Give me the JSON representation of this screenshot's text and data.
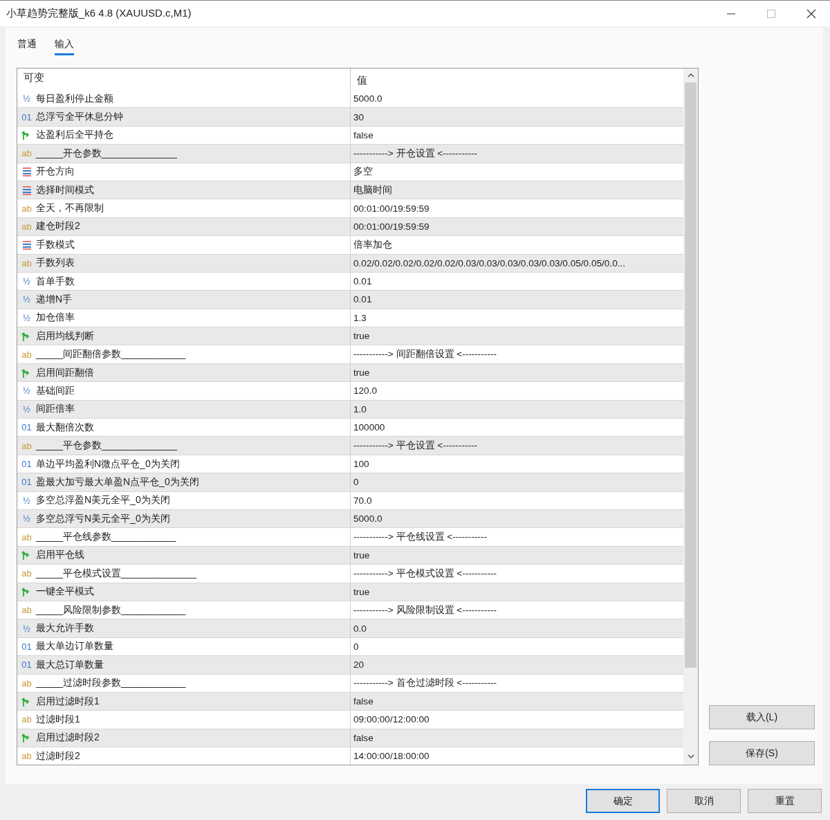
{
  "window": {
    "title": "小草趋势完整版_k6 4.8 (XAUUSD.c,M1)"
  },
  "tabs": [
    {
      "label": "普通",
      "selected": false
    },
    {
      "label": "输入",
      "selected": true
    }
  ],
  "table": {
    "columns": [
      "可变",
      "值"
    ],
    "rows": [
      {
        "kind": "double",
        "type_label": "½",
        "name": "每日盈利停止金额",
        "value": "5000.0"
      },
      {
        "kind": "int",
        "type_label": "01",
        "name": "总浮亏全平休息分钟",
        "value": "30"
      },
      {
        "kind": "bool",
        "name": "达盈利后全平持仓",
        "value": "false"
      },
      {
        "kind": "string",
        "type_label": "ab",
        "name": "_____开仓参数______________",
        "value": "-----------> 开仓设置 <-----------"
      },
      {
        "kind": "enum",
        "name": "开仓方向",
        "value": "多空"
      },
      {
        "kind": "enum",
        "name": "选择时间模式",
        "value": "电脑时间"
      },
      {
        "kind": "string",
        "type_label": "ab",
        "name": "全天，不再限制",
        "value": "00:01:00/19:59:59"
      },
      {
        "kind": "string",
        "type_label": "ab",
        "name": "建仓时段2",
        "value": "00:01:00/19:59:59"
      },
      {
        "kind": "enum",
        "name": "手数模式",
        "value": "倍率加仓"
      },
      {
        "kind": "string",
        "type_label": "ab",
        "name": "手数列表",
        "value": "0.02/0.02/0.02/0.02/0.02/0.03/0.03/0.03/0.03/0.03/0.05/0.05/0.0..."
      },
      {
        "kind": "double",
        "type_label": "½",
        "name": "首单手数",
        "value": "0.01"
      },
      {
        "kind": "double",
        "type_label": "½",
        "name": "递增N手",
        "value": "0.01"
      },
      {
        "kind": "double",
        "type_label": "½",
        "name": "加仓倍率",
        "value": "1.3"
      },
      {
        "kind": "bool",
        "name": "启用均线判断",
        "value": "true"
      },
      {
        "kind": "string",
        "type_label": "ab",
        "name": "_____间距翻倍参数____________",
        "value": "-----------> 间距翻倍设置 <-----------"
      },
      {
        "kind": "bool",
        "name": "启用间距翻倍",
        "value": "true"
      },
      {
        "kind": "double",
        "type_label": "½",
        "name": "基础间距",
        "value": "120.0"
      },
      {
        "kind": "double",
        "type_label": "½",
        "name": "间距倍率",
        "value": "1.0"
      },
      {
        "kind": "int",
        "type_label": "01",
        "name": "最大翻倍次数",
        "value": "100000"
      },
      {
        "kind": "string",
        "type_label": "ab",
        "name": "_____平仓参数______________",
        "value": "-----------> 平仓设置 <-----------"
      },
      {
        "kind": "int",
        "type_label": "01",
        "name": "单边平均盈利N微点平仓_0为关闭",
        "value": "100"
      },
      {
        "kind": "int",
        "type_label": "01",
        "name": "盈最大加亏最大单盈N点平仓_0为关闭",
        "value": "0"
      },
      {
        "kind": "double",
        "type_label": "½",
        "name": "多空总浮盈N美元全平_0为关闭",
        "value": "70.0"
      },
      {
        "kind": "double",
        "type_label": "½",
        "name": "多空总浮亏N美元全平_0为关闭",
        "value": "5000.0"
      },
      {
        "kind": "string",
        "type_label": "ab",
        "name": "_____平仓线参数____________",
        "value": "-----------> 平仓线设置 <-----------"
      },
      {
        "kind": "bool",
        "name": "启用平仓线",
        "value": "true"
      },
      {
        "kind": "string",
        "type_label": "ab",
        "name": "_____平仓模式设置______________",
        "value": "-----------> 平仓模式设置 <-----------"
      },
      {
        "kind": "bool",
        "name": "一键全平模式",
        "value": "true"
      },
      {
        "kind": "string",
        "type_label": "ab",
        "name": "_____风险限制参数____________",
        "value": "-----------> 风险限制设置 <-----------"
      },
      {
        "kind": "double",
        "type_label": "½",
        "name": "最大允许手数",
        "value": "0.0"
      },
      {
        "kind": "int",
        "type_label": "01",
        "name": "最大单边订单数量",
        "value": "0"
      },
      {
        "kind": "int",
        "type_label": "01",
        "name": "最大总订单数量",
        "value": "20"
      },
      {
        "kind": "string",
        "type_label": "ab",
        "name": "_____过滤时段参数____________",
        "value": "-----------> 首仓过滤时段 <-----------"
      },
      {
        "kind": "bool",
        "name": "启用过滤时段1",
        "value": "false"
      },
      {
        "kind": "string",
        "type_label": "ab",
        "name": "过滤时段1",
        "value": "09:00:00/12:00:00"
      },
      {
        "kind": "bool",
        "name": "启用过滤时段2",
        "value": "false"
      },
      {
        "kind": "string",
        "type_label": "ab",
        "name": "过滤时段2",
        "value": "14:00:00/18:00:00"
      }
    ]
  },
  "side_buttons": [
    "载入(L)",
    "保存(S)"
  ],
  "footer_buttons": [
    {
      "label": "确定",
      "selected": true
    },
    {
      "label": "取消",
      "selected": false
    },
    {
      "label": "重置",
      "selected": false
    }
  ]
}
